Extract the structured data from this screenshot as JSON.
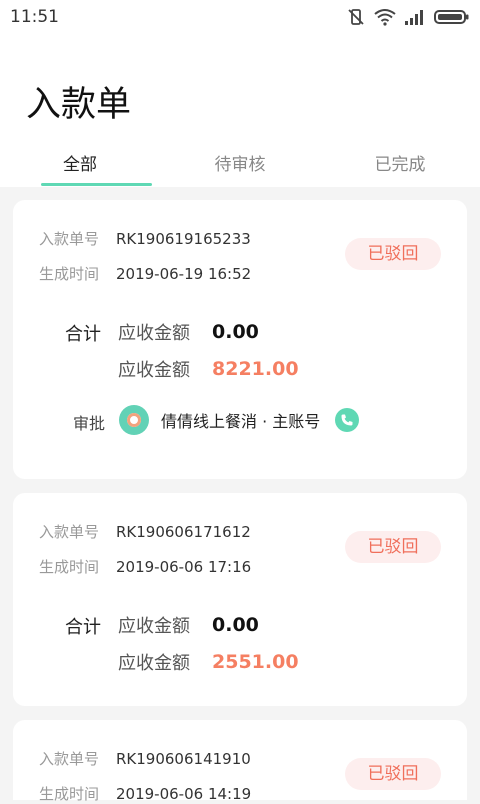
{
  "status_bar": {
    "time": "11:51"
  },
  "header": {
    "title": "入款单"
  },
  "tabs": [
    {
      "label": "全部",
      "active": true
    },
    {
      "label": "待审核",
      "active": false
    },
    {
      "label": "已完成",
      "active": false
    }
  ],
  "labels": {
    "order_no": "入款单号",
    "created": "生成时间",
    "total": "合计",
    "receivable": "应收金额",
    "approve": "审批"
  },
  "cards": [
    {
      "order_no": "RK190619165233",
      "created": "2019-06-19 16:52",
      "status": "已驳回",
      "amount1": "0.00",
      "amount2": "8221.00",
      "approver": "倩倩线上餐消 · 主账号"
    },
    {
      "order_no": "RK190606171612",
      "created": "2019-06-06 17:16",
      "status": "已驳回",
      "amount1": "0.00",
      "amount2": "2551.00"
    },
    {
      "order_no": "RK190606141910",
      "created": "2019-06-06 14:19",
      "status": "已驳回"
    }
  ],
  "colors": {
    "accent": "#5fd8b4",
    "status_text": "#f06f5b",
    "status_bg": "#fdeeee",
    "amount_highlight": "#f57f62"
  }
}
